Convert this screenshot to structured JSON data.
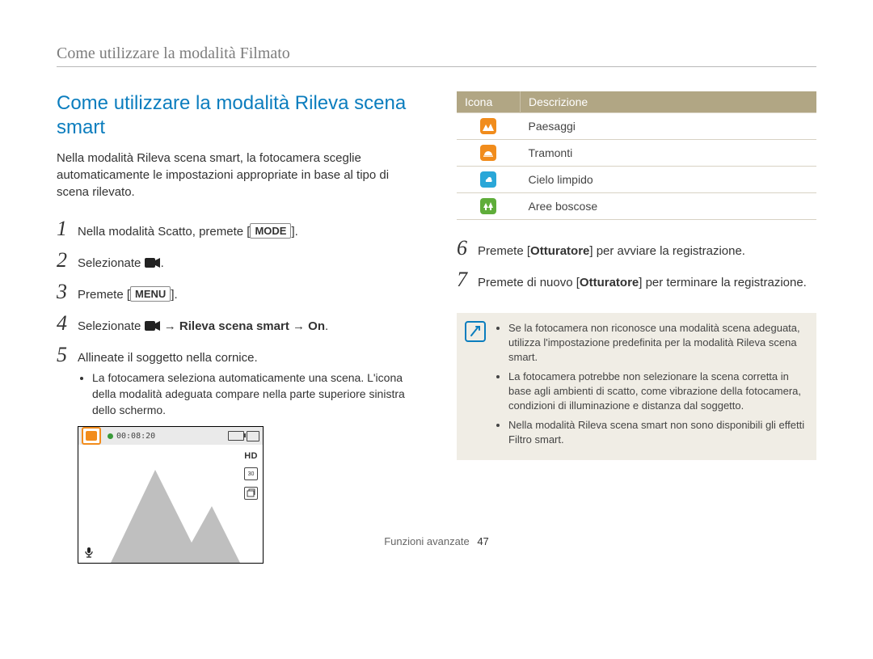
{
  "section_header": "Come utilizzare la modalità Filmato",
  "title": "Come utilizzare la modalità Rileva scena smart",
  "intro": "Nella modalità Rileva scena smart, la fotocamera sceglie automaticamente le impostazioni appropriate in base al tipo di scena rilevato.",
  "steps": {
    "s1": {
      "pre": "Nella modalità Scatto, premete [",
      "button": "MODE",
      "post": "]."
    },
    "s2": {
      "pre": "Selezionate ",
      "post": "."
    },
    "s3": {
      "pre": "Premete [",
      "button": "MENU",
      "post": "]."
    },
    "s4": {
      "pre": "Selezionate ",
      "bold": " → Rileva scena smart → On",
      "post": "."
    },
    "s5": {
      "text": "Allineate il soggetto nella cornice.",
      "sub": "La fotocamera seleziona automaticamente una scena. L'icona della modalità adeguata compare nella parte superiore sinistra dello schermo."
    },
    "s6": {
      "pre": "Premete [",
      "bold": "Otturatore",
      "post": "] per avviare la registrazione."
    },
    "s7": {
      "pre": "Premete di nuovo [",
      "bold": "Otturatore",
      "post": "] per terminare la registrazione."
    }
  },
  "screenshot": {
    "time": "00:08:20",
    "hd": "HD"
  },
  "table": {
    "header": {
      "icon": "Icona",
      "desc": "Descrizione"
    },
    "rows": [
      {
        "desc": "Paesaggi"
      },
      {
        "desc": "Tramonti"
      },
      {
        "desc": "Cielo limpido"
      },
      {
        "desc": "Aree boscose"
      }
    ]
  },
  "notes": [
    "Se la fotocamera non riconosce una modalità scena adeguata, utilizza l'impostazione predefinita per la modalità Rileva scena smart.",
    "La fotocamera potrebbe non selezionare la scena corretta in base agli ambienti di scatto, come vibrazione della fotocamera, condizioni di illuminazione e distanza dal soggetto.",
    "Nella modalità Rileva scena smart non sono disponibili gli effetti Filtro smart."
  ],
  "footer": {
    "label": "Funzioni avanzate",
    "page": "47"
  }
}
